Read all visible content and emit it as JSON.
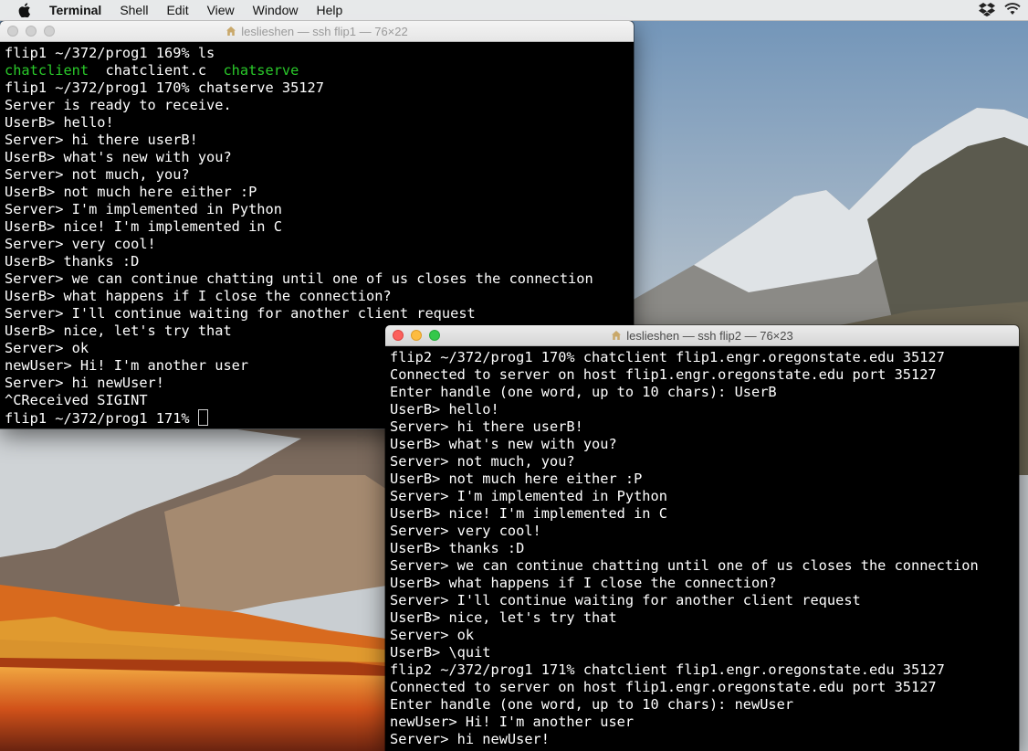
{
  "menubar": {
    "app_name": "Terminal",
    "items": [
      "Shell",
      "Edit",
      "View",
      "Window",
      "Help"
    ]
  },
  "window1": {
    "title": "leslieshen — ssh flip1 — 76×22",
    "lines": [
      "flip1 ~/372/prog1 169% ls",
      "",
      "flip1 ~/372/prog1 170% chatserve 35127",
      "Server is ready to receive.",
      "UserB> hello!",
      "Server> hi there userB!",
      "UserB> what's new with you?",
      "Server> not much, you?",
      "UserB> not much here either :P",
      "Server> I'm implemented in Python",
      "UserB> nice! I'm implemented in C",
      "Server> very cool!",
      "UserB> thanks :D",
      "Server> we can continue chatting until one of us closes the connection",
      "UserB> what happens if I close the connection?",
      "Server> I'll continue waiting for another client request",
      "UserB> nice, let's try that",
      "Server> ok",
      "newUser> Hi! I'm another user",
      "Server> hi newUser!",
      "^CReceived SIGINT",
      "flip1 ~/372/prog1 171% "
    ],
    "ls_output": {
      "file1": "chatclient",
      "file2": "chatclient.c",
      "file3": "chatserve"
    }
  },
  "window2": {
    "title": "leslieshen — ssh flip2 — 76×23",
    "lines": [
      "flip2 ~/372/prog1 170% chatclient flip1.engr.oregonstate.edu 35127",
      "Connected to server on host flip1.engr.oregonstate.edu port 35127",
      "Enter handle (one word, up to 10 chars): UserB",
      "UserB> hello!",
      "Server> hi there userB!",
      "UserB> what's new with you?",
      "Server> not much, you?",
      "UserB> not much here either :P",
      "Server> I'm implemented in Python",
      "UserB> nice! I'm implemented in C",
      "Server> very cool!",
      "UserB> thanks :D",
      "Server> we can continue chatting until one of us closes the connection",
      "UserB> what happens if I close the connection?",
      "Server> I'll continue waiting for another client request",
      "UserB> nice, let's try that",
      "Server> ok",
      "UserB> \\quit",
      "flip2 ~/372/prog1 171% chatclient flip1.engr.oregonstate.edu 35127",
      "Connected to server on host flip1.engr.oregonstate.edu port 35127",
      "Enter handle (one word, up to 10 chars): newUser",
      "newUser> Hi! I'm another user",
      "Server> hi newUser!"
    ]
  },
  "colors": {
    "ls_executable": "#2ac92a",
    "terminal_bg": "#000000",
    "terminal_fg": "#ffffff"
  }
}
